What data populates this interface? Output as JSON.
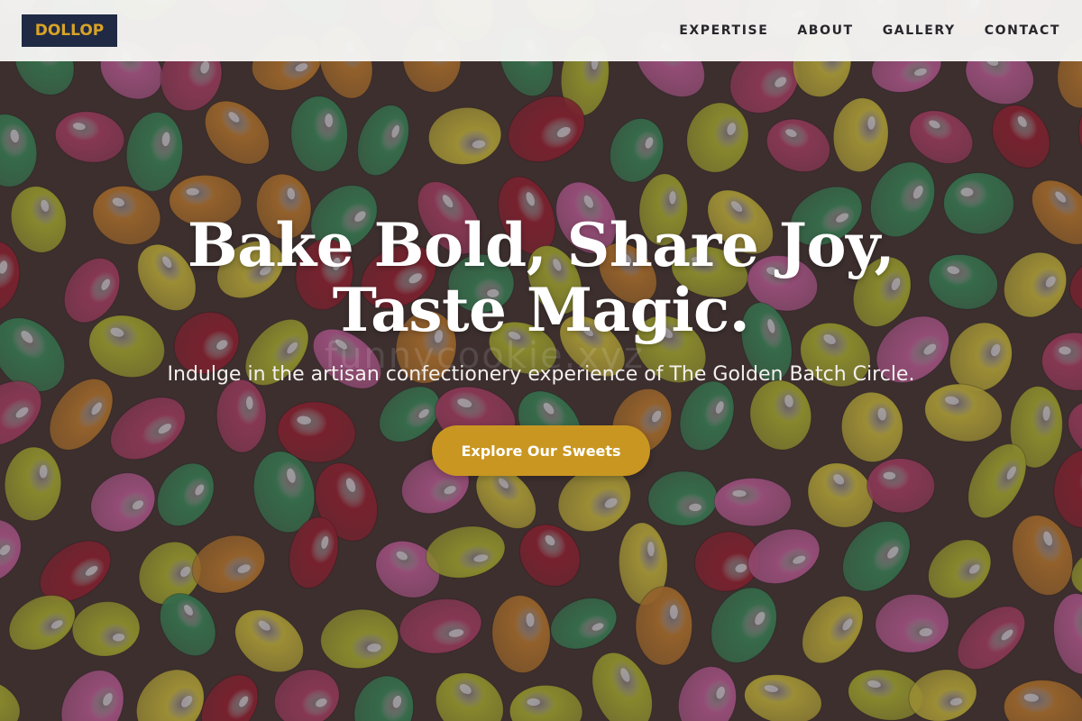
{
  "brand": {
    "logo_text": "DOLLOP",
    "logo_bg": "#202a44",
    "logo_color": "#d8a326"
  },
  "nav": {
    "items": [
      {
        "label": "EXPERTISE"
      },
      {
        "label": "ABOUT"
      },
      {
        "label": "GALLERY"
      },
      {
        "label": "CONTACT"
      }
    ]
  },
  "hero": {
    "headline_line1": "Bake Bold, Share Joy,",
    "headline_line2": "Taste Magic.",
    "subtitle": "Indulge in the artisan confectionery experience of The Golden Batch Circle.",
    "cta_label": "Explore Our Sweets",
    "watermark": "funnycookie.xyz",
    "background_image": "jelly-beans-photo",
    "bean_colors": [
      "#3f9a5c",
      "#c2c92e",
      "#c0486a",
      "#d48a2a",
      "#d66aa3",
      "#a8262f",
      "#e3d33a"
    ]
  },
  "colors": {
    "accent": "#c99622",
    "nav_bg": "#f4f4f2",
    "text_dark": "#26262b"
  }
}
